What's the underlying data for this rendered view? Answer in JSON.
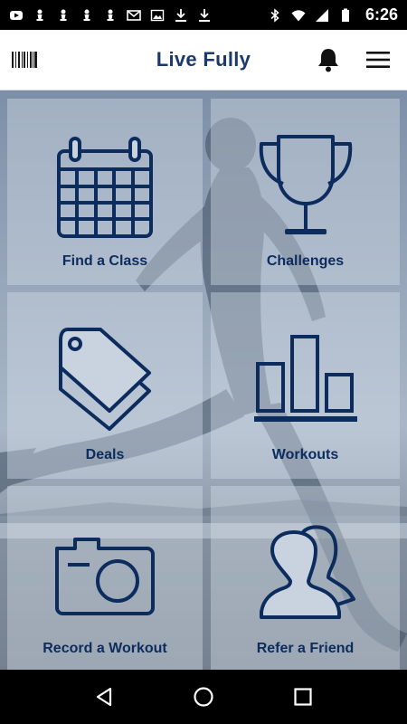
{
  "status_bar": {
    "time": "6:26",
    "left_icons": [
      "youtube-icon",
      "chess-pawn-icon",
      "chess-pawn-icon",
      "chess-pawn-icon",
      "chess-pawn-icon",
      "gmail-icon",
      "image-icon",
      "download-icon",
      "download-icon"
    ],
    "right_icons": [
      "bluetooth-icon",
      "wifi-icon",
      "signal-icon",
      "battery-icon"
    ]
  },
  "app_bar": {
    "title": "Live Fully",
    "left_icon": "barcode-icon",
    "right_icons": [
      "bell-icon",
      "menu-icon"
    ]
  },
  "tiles": [
    {
      "label": "Find a Class",
      "icon": "calendar-icon"
    },
    {
      "label": "Challenges",
      "icon": "trophy-icon"
    },
    {
      "label": "Deals",
      "icon": "tag-icon"
    },
    {
      "label": "Workouts",
      "icon": "bar-chart-icon"
    },
    {
      "label": "Record a Workout",
      "icon": "camera-icon"
    },
    {
      "label": "Refer a Friend",
      "icon": "users-icon"
    }
  ],
  "nav_bar": {
    "buttons": [
      "back-icon",
      "home-icon",
      "recents-icon"
    ]
  },
  "colors": {
    "brand_navy": "#1b3a6b",
    "icon_navy": "#0c2c5e",
    "tile_overlay": "#d4dde8"
  }
}
